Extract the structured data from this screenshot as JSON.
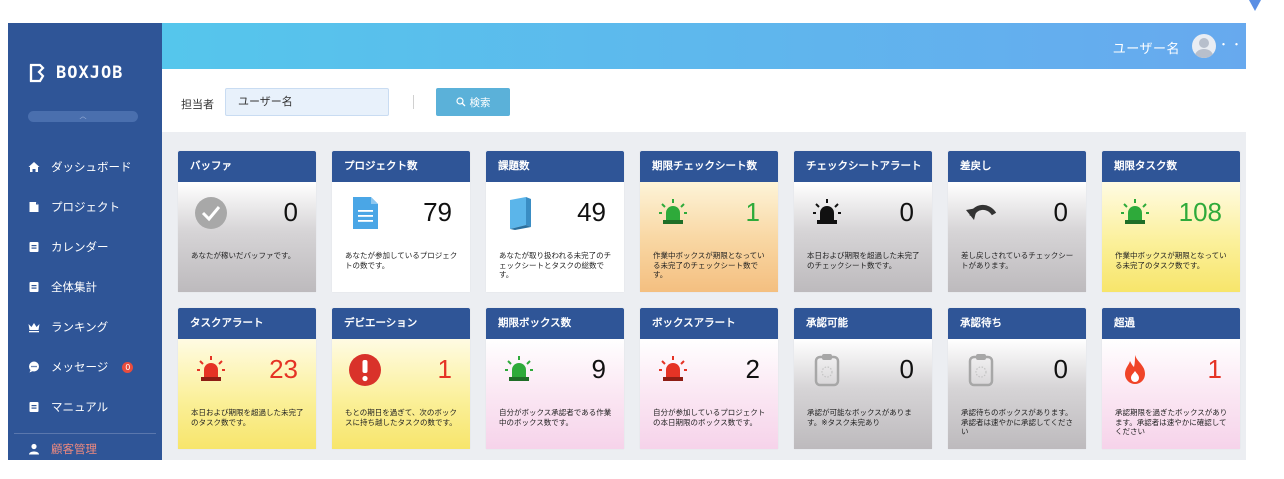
{
  "app": {
    "logo_text": "BOXJOB"
  },
  "header": {
    "user_name": "ユーザー名",
    "more": "・・"
  },
  "sidebar": {
    "collapse_icon": "chevron-up-icon",
    "items": [
      {
        "label": "ダッシュボード",
        "icon": "home-icon"
      },
      {
        "label": "プロジェクト",
        "icon": "folder-icon"
      },
      {
        "label": "カレンダー",
        "icon": "calendar-icon"
      },
      {
        "label": "全体集計",
        "icon": "summary-icon"
      },
      {
        "label": "ランキング",
        "icon": "crown-icon"
      },
      {
        "label": "メッセージ",
        "icon": "chat-icon",
        "badge": "0"
      },
      {
        "label": "マニュアル",
        "icon": "book-icon"
      },
      {
        "label": "顧客管理",
        "icon": "user-icon"
      }
    ]
  },
  "filter": {
    "label": "担当者",
    "value": "ユーザー名",
    "search_label": "検索"
  },
  "cards": [
    {
      "title": "バッファ",
      "value": "0",
      "icon": "check-circle-icon",
      "desc": "あなたが稼いだバッファです。",
      "theme": "gray",
      "value_color": "#111111"
    },
    {
      "title": "プロジェクト数",
      "value": "79",
      "icon": "document-icon",
      "desc": "あなたが参加しているプロジェクトの数です。",
      "theme": "white",
      "value_color": "#111111"
    },
    {
      "title": "課題数",
      "value": "49",
      "icon": "book-icon",
      "desc": "あなたが取り扱われる未完了のチェックシートとタスクの総数です。",
      "theme": "white",
      "value_color": "#111111"
    },
    {
      "title": "期限チェックシート数",
      "value": "1",
      "icon": "green-siren-icon",
      "desc": "作業中ボックスが期限となっている未完了のチェックシート数です。",
      "theme": "orange",
      "value_color": "#2eaa3a"
    },
    {
      "title": "チェックシートアラート",
      "value": "0",
      "icon": "black-siren-icon",
      "desc": "本日および期限を超過した未完了のチェックシート数です。",
      "theme": "gray",
      "value_color": "#111111"
    },
    {
      "title": "差戻し",
      "value": "0",
      "icon": "undo-arrow-icon",
      "desc": "差し戻しされているチェックシートがあります。",
      "theme": "gray",
      "value_color": "#111111"
    },
    {
      "title": "期限タスク数",
      "value": "108",
      "icon": "green-siren-icon",
      "desc": "作業中ボックスが期限となっている未完了のタスク数です。",
      "theme": "yellow",
      "value_color": "#2eaa3a"
    },
    {
      "title": "タスクアラート",
      "value": "23",
      "icon": "red-siren-icon",
      "desc": "本日および期限を超過した未完了のタスク数です。",
      "theme": "yellow",
      "value_color": "#e53325"
    },
    {
      "title": "デビエーション",
      "value": "1",
      "icon": "exclamation-icon",
      "desc": "もとの期日を過ぎて、次のボックスに持ち越したタスクの数です。",
      "theme": "yellow",
      "value_color": "#e53325"
    },
    {
      "title": "期限ボックス数",
      "value": "9",
      "icon": "green-siren-icon",
      "desc": "自分がボックス承認者である作業中のボックス数です。",
      "theme": "pink",
      "value_color": "#111111"
    },
    {
      "title": "ボックスアラート",
      "value": "2",
      "icon": "red-siren-icon",
      "desc": "自分が参加しているプロジェクトの本日期限のボックス数です。",
      "theme": "pink",
      "value_color": "#111111"
    },
    {
      "title": "承認可能",
      "value": "0",
      "icon": "clipboard-icon",
      "desc": "承認が可能なボックスがあります。※タスク未完あり",
      "theme": "gray",
      "value_color": "#111111"
    },
    {
      "title": "承認待ち",
      "value": "0",
      "icon": "clipboard-icon",
      "desc": "承認待ちのボックスがあります。承認者は速やかに承認してください",
      "theme": "gray",
      "value_color": "#111111"
    },
    {
      "title": "超過",
      "value": "1",
      "icon": "fire-icon",
      "desc": "承認期限を過ぎたボックスがあります。承認者は速やかに確認してください",
      "theme": "pink",
      "value_color": "#e53325"
    }
  ]
}
